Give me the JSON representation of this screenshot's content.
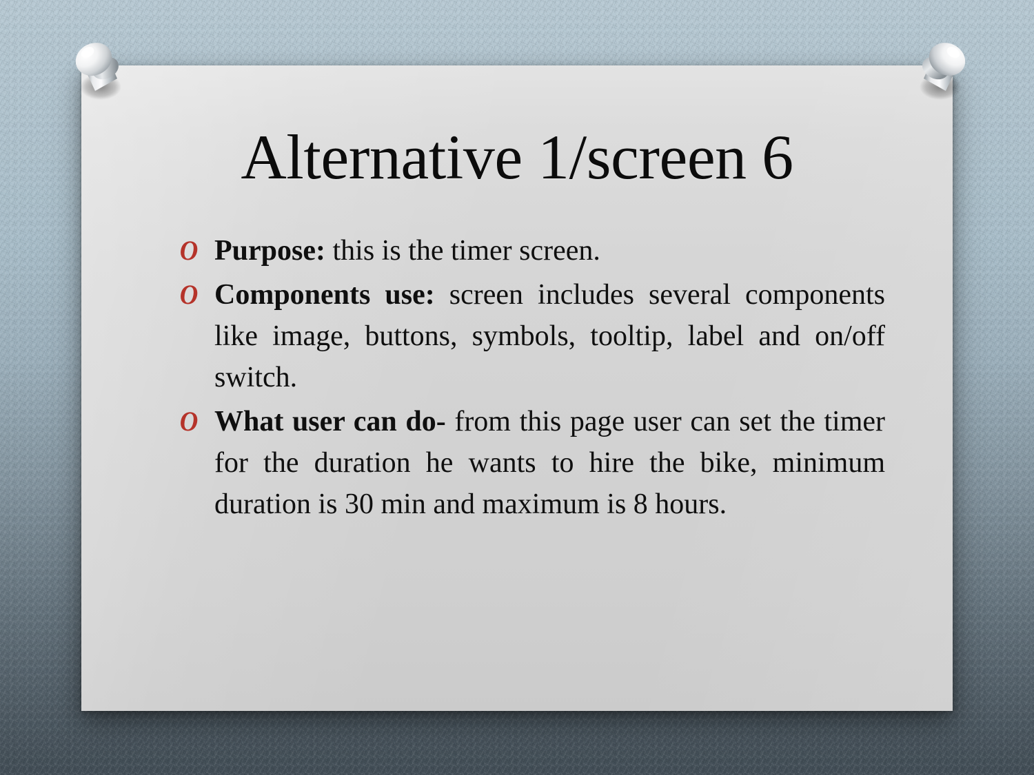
{
  "slide": {
    "title": "Alternative 1/screen 6",
    "bullet_glyph": "O",
    "bullet_color": "#b5332a",
    "card_color": "#d2d2d2",
    "background_color": "#a7bcc8",
    "pin_icon": "pushpin-icon",
    "bullets": [
      {
        "lead": "Purpose:",
        "rest": " this is the timer screen."
      },
      {
        "lead": "Components use:",
        "rest": " screen includes several components like image, buttons, symbols, tooltip, label and on/off switch."
      },
      {
        "lead": "What user can do-",
        "rest": " from this page user can set the timer for the duration he wants to hire the bike, minimum duration is 30 min and maximum is 8 hours."
      }
    ]
  }
}
